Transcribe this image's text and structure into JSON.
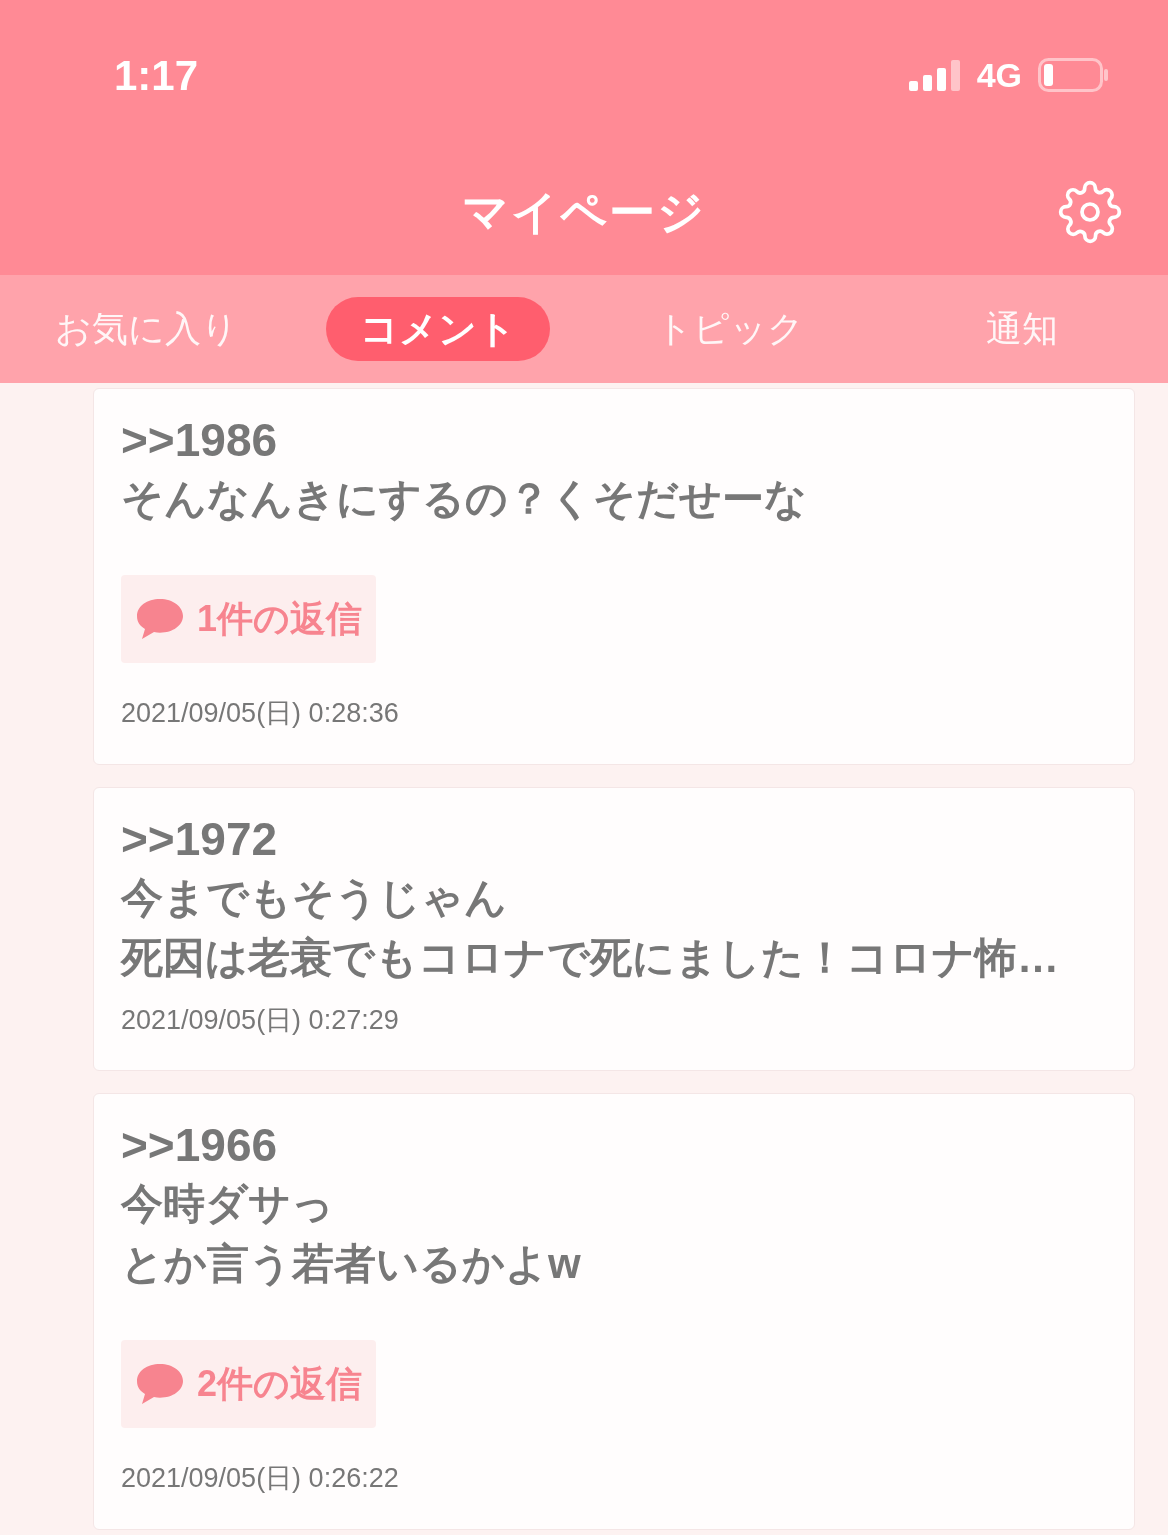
{
  "status_bar": {
    "time": "1:17",
    "network": "4G"
  },
  "header": {
    "title": "マイページ"
  },
  "tabs": [
    {
      "label": "お気に入り",
      "selected": false
    },
    {
      "label": "コメント",
      "selected": true
    },
    {
      "label": "トピック",
      "selected": false
    },
    {
      "label": "通知",
      "selected": false
    }
  ],
  "comments": [
    {
      "anchor": ">>1986",
      "lines": [
        "そんなんきにするの？くそだせーな"
      ],
      "replies": "1件の返信",
      "date": "2021/09/05(日) 0:28:36"
    },
    {
      "anchor": ">>1972",
      "lines": [
        "今までもそうじゃん",
        "死因は老衰でもコロナで死にました！コロナ怖…"
      ],
      "date": "2021/09/05(日) 0:27:29"
    },
    {
      "anchor": ">>1966",
      "lines": [
        "今時ダサっ",
        "とか言う若者いるかよw"
      ],
      "replies": "2件の返信",
      "date": "2021/09/05(日) 0:26:22"
    }
  ]
}
